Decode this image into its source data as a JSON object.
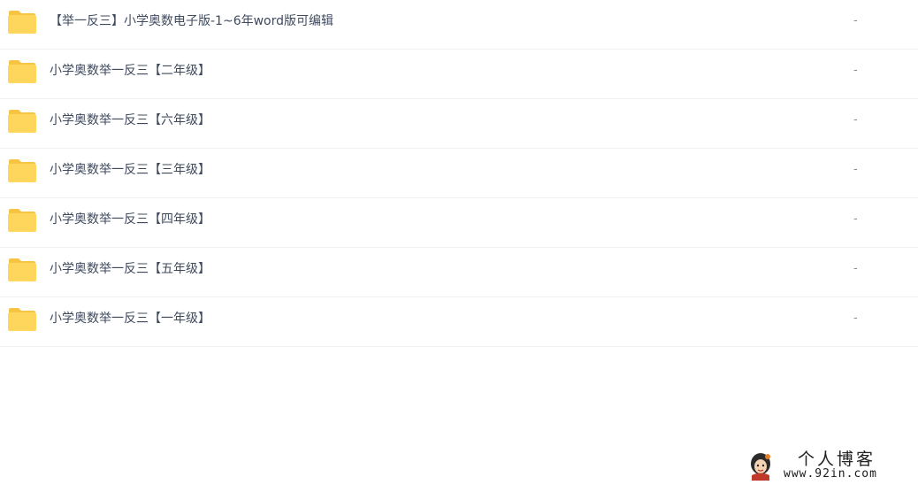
{
  "files": [
    {
      "name": "【举一反三】小学奥数电子版-1~6年word版可编辑",
      "size": "-",
      "icon": "folder-icon"
    },
    {
      "name": "小学奥数举一反三【二年级】",
      "size": "-",
      "icon": "folder-icon"
    },
    {
      "name": "小学奥数举一反三【六年级】",
      "size": "-",
      "icon": "folder-icon"
    },
    {
      "name": "小学奥数举一反三【三年级】",
      "size": "-",
      "icon": "folder-icon"
    },
    {
      "name": "小学奥数举一反三【四年级】",
      "size": "-",
      "icon": "folder-icon"
    },
    {
      "name": "小学奥数举一反三【五年级】",
      "size": "-",
      "icon": "folder-icon"
    },
    {
      "name": "小学奥数举一反三【一年级】",
      "size": "-",
      "icon": "folder-icon"
    }
  ],
  "watermark": {
    "title": "个人博客",
    "url": "www.92in.com"
  },
  "colors": {
    "folder": "#ffd65c",
    "folder_tab": "#f6c443",
    "row_divider": "#f1f2f4",
    "text": "#3f4a5f"
  }
}
